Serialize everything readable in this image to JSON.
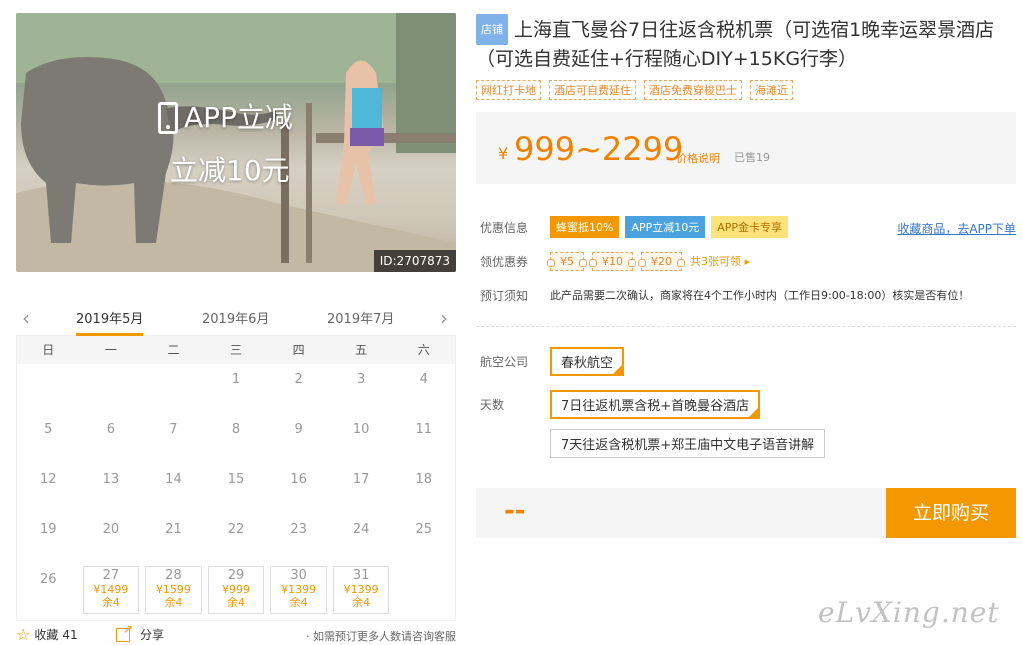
{
  "photo": {
    "overlay_line1": "APP立减",
    "overlay_line2": "立减10元",
    "id_label": "ID:2707873"
  },
  "calendar": {
    "months": [
      "2019年5月",
      "2019年6月",
      "2019年7月"
    ],
    "active_month_index": 0,
    "weekdays": [
      "日",
      "一",
      "二",
      "三",
      "四",
      "五",
      "六"
    ],
    "weeks": [
      [
        "",
        "",
        "",
        "1",
        "2",
        "3",
        "4"
      ],
      [
        "5",
        "6",
        "7",
        "8",
        "9",
        "10",
        "11"
      ],
      [
        "12",
        "13",
        "14",
        "15",
        "16",
        "17",
        "18"
      ],
      [
        "19",
        "20",
        "21",
        "22",
        "23",
        "24",
        "25"
      ]
    ],
    "last_week": {
      "plain_day": "26",
      "available": [
        {
          "day": "27",
          "price": "¥1499",
          "stock": "余4"
        },
        {
          "day": "28",
          "price": "¥1599",
          "stock": "余4"
        },
        {
          "day": "29",
          "price": "¥999",
          "stock": "余4"
        },
        {
          "day": "30",
          "price": "¥1399",
          "stock": "余4"
        },
        {
          "day": "31",
          "price": "¥1399",
          "stock": "余4"
        }
      ]
    }
  },
  "bottom": {
    "fav_label": "收藏",
    "fav_count": "41",
    "share_label": "分享",
    "hint": "· 如需预订更多人数请咨询客服"
  },
  "product": {
    "store_badge": "店铺",
    "title": "上海直飞曼谷7日往返含税机票（可选宿1晚幸运翠景酒店（可选自费延住+行程随心DIY+15KG行李）",
    "tags": [
      "网红打卡地",
      "酒店可自费延住",
      "酒店免费穿梭巴士",
      "海滩近"
    ],
    "price_symbol": "¥",
    "price": "999~2299",
    "price_explain": "价格说明",
    "sold": "已售19"
  },
  "info": {
    "promo_label": "优惠信息",
    "promos": [
      "蜂蜜抵10%",
      "APP立减10元",
      "APP金卡专享"
    ],
    "fav_link": "收藏商品，去APP下单",
    "coupon_label": "领优惠券",
    "coupons": [
      "¥5",
      "¥10",
      "¥20"
    ],
    "coupon_more": "共3张可领 ▸",
    "notice_label": "预订须知",
    "notice": "此产品需要二次确认，商家将在4个工作小时内（工作日9:00-18:00）核实是否有位！"
  },
  "options": {
    "airline_label": "航空公司",
    "airline": "春秋航空",
    "days_label": "天数",
    "days_options": [
      "7日往返机票含税+首晚曼谷酒店",
      "7天往返含税机票+郑王庙中文电子语音讲解"
    ]
  },
  "buy": {
    "total": "--",
    "button": "立即购买"
  },
  "watermark": "eLvXing.net",
  "colors": {
    "accent": "#f39800",
    "price": "#f08200",
    "link": "#3677c7"
  }
}
